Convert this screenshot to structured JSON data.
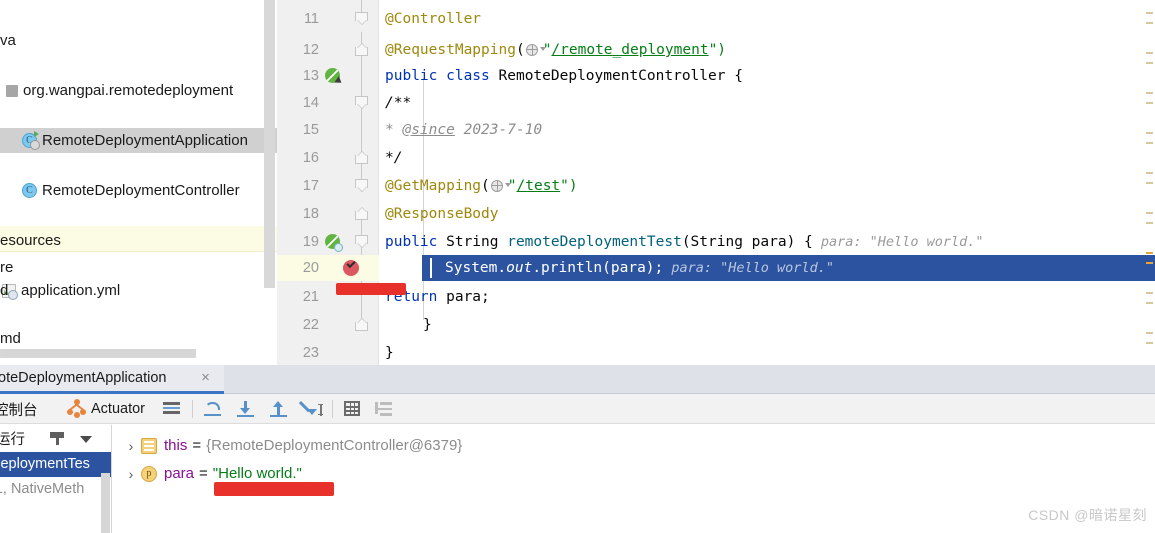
{
  "colors": {
    "selection_blue": "#2c53a0",
    "tab_underline": "#3b74c4",
    "current_line_yellow": "#fcfbe3",
    "annotation_red": "#e8312a",
    "keyword_blue": "#0033b3",
    "string_green": "#067d17",
    "annotation_olive": "#9e880d",
    "comment_gray": "#8c8c8c",
    "variable_purple": "#871094",
    "breakpoint_red": "#db5860",
    "run_green": "#62b543",
    "actuator_orange": "#e8853c"
  },
  "sidebar": {
    "name": "project-tree",
    "items": [
      {
        "label": "va",
        "icon": "none",
        "indent": 0,
        "selected": false,
        "clipped": true
      },
      {
        "label": "org.wangpai.remotedeployment",
        "icon": "folder-icon",
        "indent": 1,
        "selected": false,
        "clipped": false
      },
      {
        "label": "RemoteDeploymentApplication",
        "icon": "java-class-runnable-icon",
        "indent": 2,
        "selected": true,
        "clipped": false
      },
      {
        "label": "RemoteDeploymentController",
        "icon": "java-class-icon",
        "indent": 2,
        "selected": false,
        "clipped": false
      },
      {
        "label": "esources",
        "icon": "none",
        "indent": 0,
        "selected": false,
        "clipped": true
      },
      {
        "label": "application.yml",
        "icon": "yml-file-icon",
        "indent": 1,
        "selected": false,
        "clipped": false
      }
    ],
    "lower_items": [
      {
        "label": "re"
      },
      {
        "label": "d"
      },
      {
        "label": ""
      },
      {
        "label": "md"
      }
    ]
  },
  "editor": {
    "name": "code-editor",
    "language": "java",
    "current_line": 20,
    "lines": [
      {
        "num": "11",
        "fold": "down",
        "gutter_icon": "none",
        "tokens": [
          {
            "t": "@Controller",
            "c": "ann"
          }
        ]
      },
      {
        "num": "12",
        "fold": "up",
        "gutter_icon": "none",
        "tokens": [
          {
            "t": "@RequestMapping",
            "c": "ann"
          },
          {
            "t": "(",
            "c": "plain"
          },
          {
            "t": "globe-icon",
            "c": "globe"
          },
          {
            "t": "\"",
            "c": "str"
          },
          {
            "t": "/remote_deployment",
            "c": "url"
          },
          {
            "t": "\"",
            "c": "str"
          },
          {
            "t": ")",
            "c": "plain"
          }
        ]
      },
      {
        "num": "13",
        "fold": "none",
        "gutter_icon": "run-method-icon",
        "tokens": [
          {
            "t": "public ",
            "c": "kw"
          },
          {
            "t": "class ",
            "c": "kw"
          },
          {
            "t": "RemoteDeploymentController {",
            "c": "plain"
          }
        ]
      },
      {
        "num": "14",
        "fold": "down",
        "gutter_icon": "none",
        "tokens": [
          {
            "t": "    /**",
            "c": "cmt"
          }
        ]
      },
      {
        "num": "15",
        "fold": "none",
        "gutter_icon": "none",
        "tokens": [
          {
            "t": "     * ",
            "c": "cmt"
          },
          {
            "t": "@since",
            "c": "cmtl"
          },
          {
            "t": " 2023-7-10",
            "c": "cmt"
          }
        ]
      },
      {
        "num": "16",
        "fold": "up",
        "gutter_icon": "none",
        "tokens": [
          {
            "t": "     */",
            "c": "cmt"
          }
        ]
      },
      {
        "num": "17",
        "fold": "down",
        "gutter_icon": "none",
        "tokens": [
          {
            "t": "    ",
            "c": "plain"
          },
          {
            "t": "@GetMapping",
            "c": "ann"
          },
          {
            "t": "(",
            "c": "plain"
          },
          {
            "t": "globe-icon",
            "c": "globe"
          },
          {
            "t": "\"",
            "c": "str"
          },
          {
            "t": "/test",
            "c": "url"
          },
          {
            "t": "\"",
            "c": "str"
          },
          {
            "t": ")",
            "c": "plain"
          }
        ]
      },
      {
        "num": "18",
        "fold": "up",
        "gutter_icon": "none",
        "tokens": [
          {
            "t": "    ",
            "c": "plain"
          },
          {
            "t": "@ResponseBody",
            "c": "ann"
          }
        ]
      },
      {
        "num": "19",
        "fold": "down",
        "gutter_icon": "run-test-icon",
        "tokens": [
          {
            "t": "    ",
            "c": "plain"
          },
          {
            "t": "public ",
            "c": "kw"
          },
          {
            "t": "String ",
            "c": "plain"
          },
          {
            "t": "remoteDeploymentTest",
            "c": "fn"
          },
          {
            "t": "(String para) {",
            "c": "plain"
          },
          {
            "t": "   para:  \"Hello world.\"",
            "c": "hint"
          }
        ]
      },
      {
        "num": "20",
        "fold": "none",
        "gutter_icon": "breakpoint-verified-icon",
        "current": true,
        "tokens": [
          {
            "t": "    System.",
            "c": "plain"
          },
          {
            "t": "out",
            "c": "it"
          },
          {
            "t": ".println(para);",
            "c": "plain"
          },
          {
            "t": "   para:  \"Hello world.\"",
            "c": "hintw"
          }
        ]
      },
      {
        "num": "21",
        "fold": "none",
        "gutter_icon": "none",
        "tokens": [
          {
            "t": "    ",
            "c": "plain"
          },
          {
            "t": "return ",
            "c": "kw"
          },
          {
            "t": "para;",
            "c": "plain"
          }
        ]
      },
      {
        "num": "22",
        "fold": "up",
        "gutter_icon": "none",
        "tokens": [
          {
            "t": "}",
            "c": "plain"
          }
        ]
      },
      {
        "num": "23",
        "fold": "none",
        "gutter_icon": "none",
        "tokens": [
          {
            "t": "}",
            "c": "plain"
          }
        ]
      }
    ]
  },
  "debug_panel": {
    "tab": {
      "label": "oteDeploymentApplication",
      "close_label": "×",
      "active": true
    },
    "toolbar": {
      "console_tab_label": "控制台",
      "actuator_tab_label": "Actuator",
      "buttons": [
        {
          "name": "show-execution-point-icon",
          "glyph": "lines"
        },
        {
          "name": "step-over-icon",
          "glyph": "step"
        },
        {
          "name": "step-into-icon",
          "glyph": "arrow-down"
        },
        {
          "name": "step-out-icon",
          "glyph": "arrow-up"
        },
        {
          "name": "run-to-cursor-icon",
          "glyph": "to-cursor"
        },
        {
          "name": "evaluate-expression-icon",
          "glyph": "grid"
        },
        {
          "name": "sort-variables-icon",
          "glyph": "flow"
        }
      ]
    },
    "frames": {
      "header_label": "运行",
      "filter_icon": "funnel-icon",
      "dropdown_icon": "chevron-down-icon",
      "rows": [
        {
          "label": "DeploymentTes",
          "selected": true,
          "dim": false
        },
        {
          "label": "-1, NativeMeth",
          "selected": false,
          "dim": true
        }
      ]
    },
    "variables": {
      "rows": [
        {
          "toggle": "›",
          "icon": "object-variable-icon",
          "icon_letter": "",
          "name": "this",
          "eq": "=",
          "value": "{RemoteDeploymentController@6379}",
          "value_kind": "object"
        },
        {
          "toggle": "›",
          "icon": "parameter-variable-icon",
          "icon_letter": "p",
          "name": "para",
          "eq": "=",
          "value": "\"Hello world.\"",
          "value_kind": "string"
        }
      ]
    }
  },
  "annotations": [
    {
      "name": "red-underline-editor",
      "kind": "hand-drawn-underline",
      "color": "#e8312a"
    },
    {
      "name": "red-underline-variable",
      "kind": "hand-drawn-underline",
      "color": "#e8312a"
    }
  ],
  "watermark": {
    "text": "CSDN @暗诺星刻"
  }
}
